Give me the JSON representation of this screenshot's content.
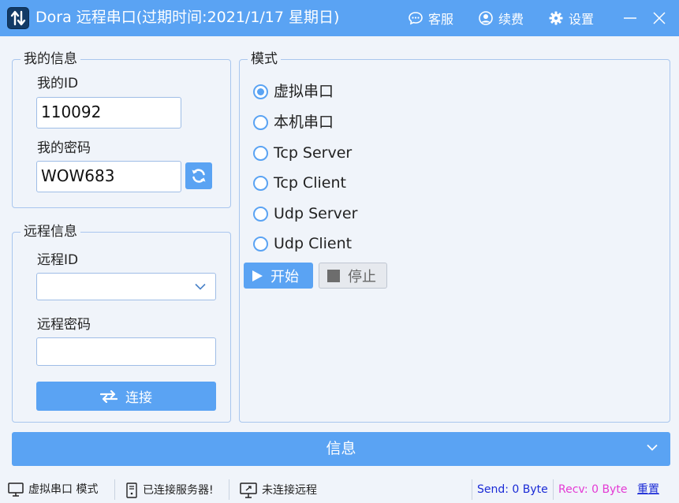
{
  "window": {
    "title": "Dora 远程串口(过期时间:2021/1/17 星期日)",
    "actions": {
      "service": "客服",
      "renew": "续费",
      "settings": "设置"
    }
  },
  "my_info": {
    "group_title": "我的信息",
    "id_label": "我的ID",
    "id_value": "110092",
    "password_label": "我的密码",
    "password_value": "WOW683"
  },
  "remote_info": {
    "group_title": "远程信息",
    "id_label": "远程ID",
    "id_value": "",
    "password_label": "远程密码",
    "password_value": "",
    "connect_label": "连接"
  },
  "mode": {
    "group_title": "模式",
    "options": [
      {
        "label": "虚拟串口",
        "selected": true
      },
      {
        "label": "本机串口",
        "selected": false
      },
      {
        "label": "Tcp Server",
        "selected": false
      },
      {
        "label": "Tcp Client",
        "selected": false
      },
      {
        "label": "Udp Server",
        "selected": false
      },
      {
        "label": "Udp Client",
        "selected": false
      }
    ],
    "start_label": "开始",
    "stop_label": "停止"
  },
  "info_panel": {
    "label": "信息"
  },
  "statusbar": {
    "mode_text": "虚拟串口 模式",
    "server_text": "已连接服务器!",
    "remote_text": "未连接远程",
    "send_text": "Send: 0 Byte",
    "recv_text": "Recv: 0 Byte",
    "reset_label": "重置"
  },
  "colors": {
    "accent": "#5aa3f3",
    "send": "#1a2ad6",
    "recv": "#e43ad4"
  }
}
